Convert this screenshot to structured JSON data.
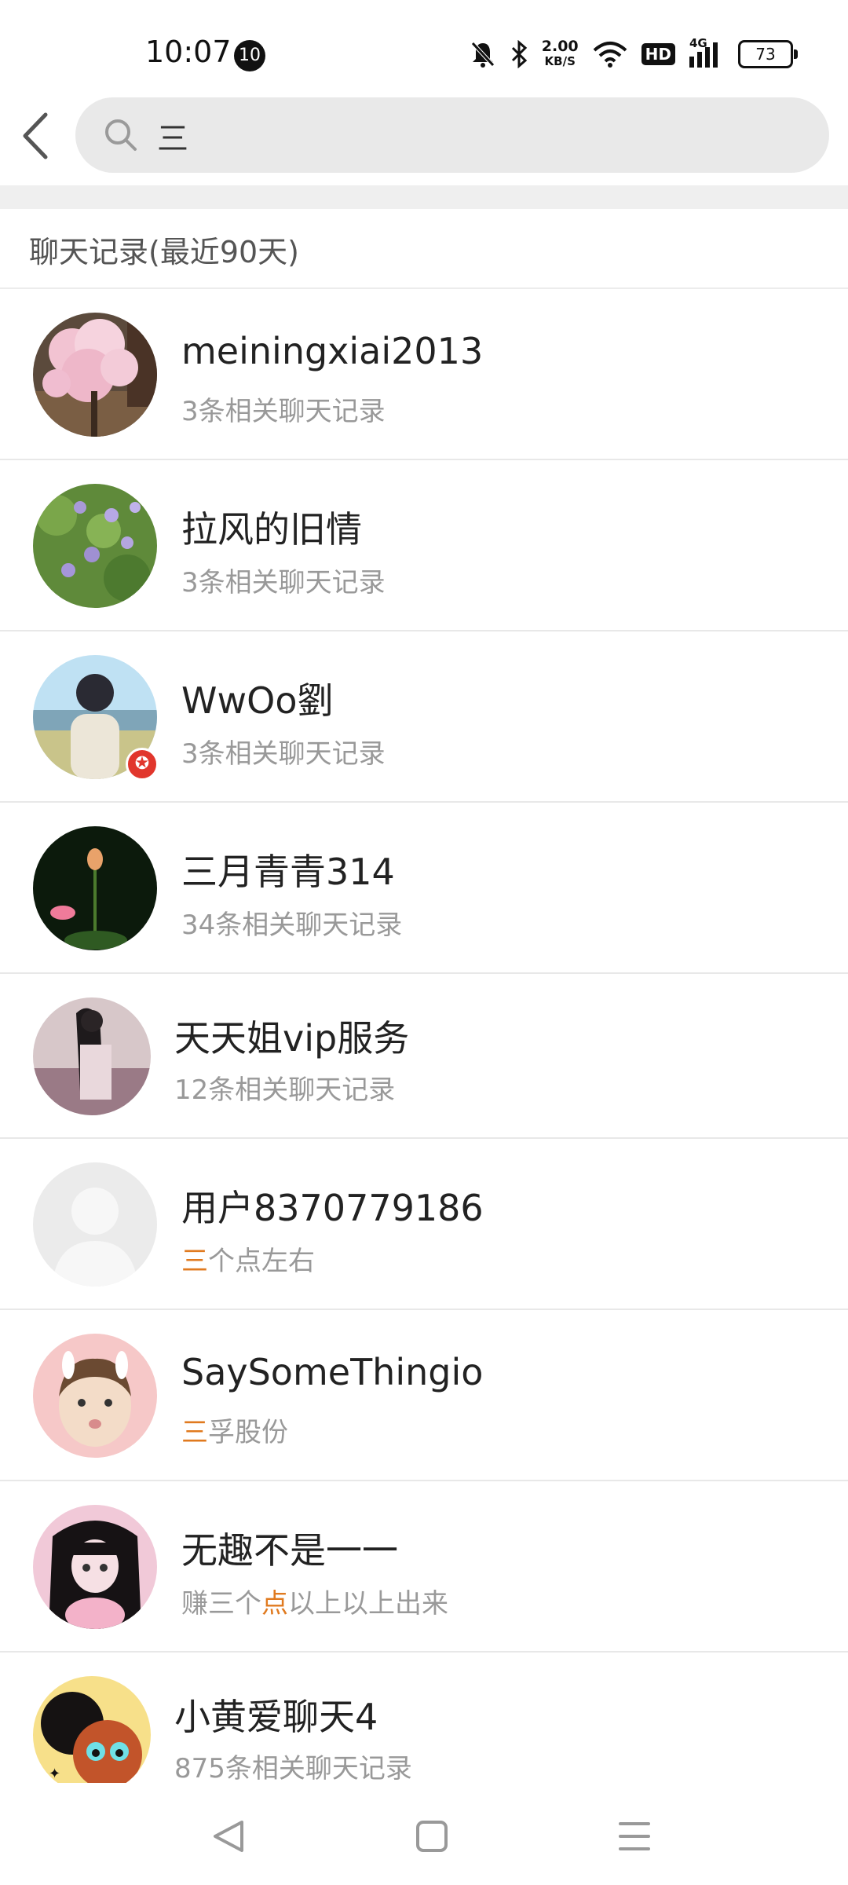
{
  "status_bar": {
    "time": "10:07",
    "notification_count": "10",
    "net_speed_value": "2.00",
    "net_speed_unit": "KB/S",
    "hd_label": "HD",
    "signal_label": "4G",
    "battery": "73",
    "icons": [
      "mute-bell-icon",
      "bluetooth-icon",
      "wifi-icon",
      "signal-icon",
      "battery-icon"
    ]
  },
  "search": {
    "query": "三",
    "icons": [
      "back-arrow-icon",
      "search-icon"
    ]
  },
  "section": {
    "title": "聊天记录(最近90天)"
  },
  "results": [
    {
      "name": "meiningxiai2013",
      "sub_pre": "3条相关聊天记录",
      "sub_hl": "",
      "sub_post": ""
    },
    {
      "name": "拉风的旧情",
      "sub_pre": "3条相关聊天记录",
      "sub_hl": "",
      "sub_post": ""
    },
    {
      "name": "WwOo劉",
      "sub_pre": "3条相关聊天记录",
      "sub_hl": "",
      "sub_post": ""
    },
    {
      "name": "三月青青314",
      "sub_pre": "34条相关聊天记录",
      "sub_hl": "",
      "sub_post": ""
    },
    {
      "name": "天天姐vip服务",
      "sub_pre": "12条相关聊天记录",
      "sub_hl": "",
      "sub_post": ""
    },
    {
      "name": "用户8370779186",
      "sub_pre": "",
      "sub_hl": "三",
      "sub_post": "个点左右"
    },
    {
      "name": "SaySomeThingio",
      "sub_pre": "",
      "sub_hl": "三",
      "sub_post": "孚股份"
    },
    {
      "name": "无趣不是一一",
      "sub_pre": "赚三个",
      "sub_hl": "点",
      "sub_post": "以上以上出来"
    },
    {
      "name": "小黄爱聊天4",
      "sub_pre": "875条相关聊天记录",
      "sub_hl": "",
      "sub_post": ""
    }
  ],
  "colors": {
    "highlight": "#e07a1f",
    "search_bg": "#e9e9e9",
    "badge_red": "#e1362c"
  },
  "nav_bar": {
    "icons": [
      "back-triangle-icon",
      "home-square-icon",
      "menu-lines-icon"
    ]
  }
}
